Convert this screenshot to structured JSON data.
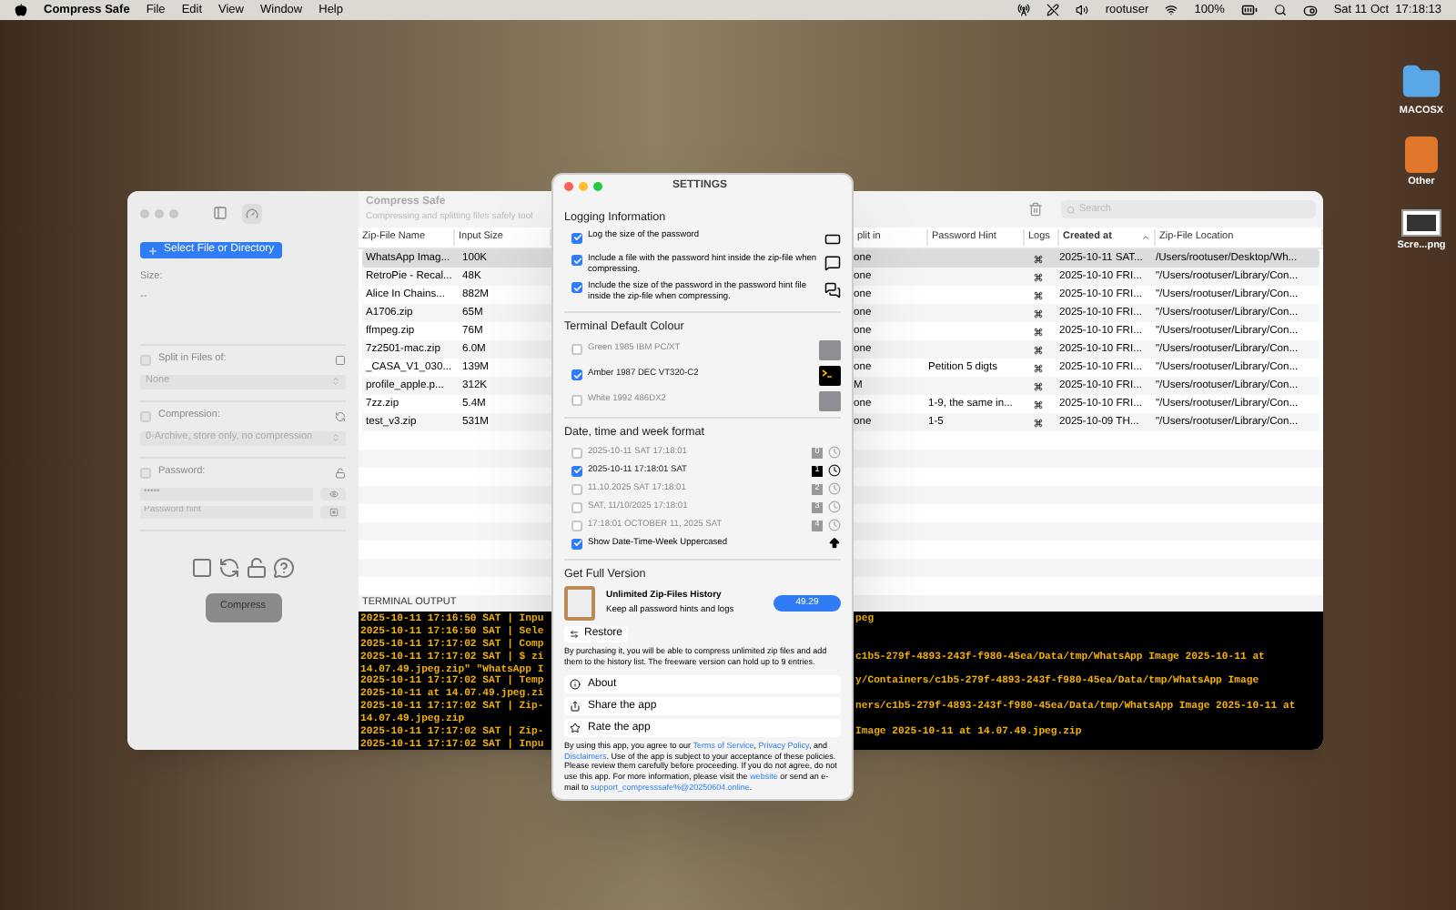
{
  "menu_bar": {
    "app_name": "Compress Safe",
    "menus": [
      "File",
      "Edit",
      "View",
      "Window",
      "Help"
    ],
    "user": "rootuser",
    "battery": "100%",
    "clock": "Sat 11 Oct  17:18:13"
  },
  "desktop_icons": [
    {
      "label": "MACOSX",
      "kind": "folder"
    },
    {
      "label": "Other",
      "kind": "app"
    },
    {
      "label": "Scre...png",
      "kind": "screenshot"
    }
  ],
  "main_window": {
    "sidebar": {
      "select_button": "Select File or Directory",
      "size_label": "Size:",
      "size_value": "--",
      "split": {
        "label": "Split in Files of:",
        "checked": false,
        "value": "None"
      },
      "compression": {
        "label": "Compression:",
        "checked": false,
        "value": "0-Archive, store only, no compression"
      },
      "password": {
        "label": "Password:",
        "checked": false,
        "value": "•••••",
        "hint_placeholder": "Password hint"
      },
      "compress_button": "Compress"
    },
    "header": {
      "title": "Compress Safe",
      "subtitle": "Compressing and splitting files safely tool",
      "search_placeholder": "Search"
    },
    "table": {
      "columns": [
        {
          "label": "Zip-File Name",
          "sorted": false
        },
        {
          "label": "Input Size",
          "sorted": false
        },
        {
          "label": "plit in",
          "sorted": false
        },
        {
          "label": "Password Hint",
          "sorted": false
        },
        {
          "label": "Logs",
          "sorted": false
        },
        {
          "label": "Created at",
          "sorted": true
        },
        {
          "label": "Zip-File Location",
          "sorted": false
        }
      ],
      "rows": [
        {
          "selected": true,
          "cells": [
            "WhatsApp Imag...",
            "100K",
            "one",
            "",
            "",
            "2025-10-11 SAT...",
            "/Users/rootuser/Desktop/Wh..."
          ]
        },
        {
          "selected": false,
          "cells": [
            "RetroPie - Recal...",
            "48K",
            "one",
            "",
            "",
            "2025-10-10 FRI...",
            "\"/Users/rootuser/Library/Con..."
          ]
        },
        {
          "selected": false,
          "cells": [
            "Alice In Chains...",
            "882M",
            "one",
            "",
            "",
            "2025-10-10 FRI...",
            "\"/Users/rootuser/Library/Con..."
          ]
        },
        {
          "selected": false,
          "cells": [
            "A1706.zip",
            "65M",
            "one",
            "",
            "",
            "2025-10-10 FRI...",
            "\"/Users/rootuser/Library/Con..."
          ]
        },
        {
          "selected": false,
          "cells": [
            "ffmpeg.zip",
            "76M",
            "one",
            "",
            "",
            "2025-10-10 FRI...",
            "\"/Users/rootuser/Library/Con..."
          ]
        },
        {
          "selected": false,
          "cells": [
            "7z2501-mac.zip",
            "6.0M",
            "one",
            "",
            "",
            "2025-10-10 FRI...",
            "\"/Users/rootuser/Library/Con..."
          ]
        },
        {
          "selected": false,
          "cells": [
            "_CASA_V1_030...",
            "139M",
            "one",
            "Petition 5 digts",
            "",
            "2025-10-10 FRI...",
            "\"/Users/rootuser/Library/Con..."
          ]
        },
        {
          "selected": false,
          "cells": [
            "profile_apple.p...",
            "312K",
            "M",
            "",
            "",
            "2025-10-10 FRI...",
            "\"/Users/rootuser/Library/Con..."
          ]
        },
        {
          "selected": false,
          "cells": [
            "7zz.zip",
            "5.4M",
            "one",
            "1-9, the same in...",
            "",
            "2025-10-10 FRI...",
            "\"/Users/rootuser/Library/Con..."
          ]
        },
        {
          "selected": false,
          "cells": [
            "test_v3.zip",
            "531M",
            "one",
            "1-5",
            "",
            "2025-10-09 TH...",
            "\"/Users/rootuser/Library/Con..."
          ]
        }
      ]
    },
    "terminal": {
      "title": "TERMINAL OUTPUT",
      "lines": [
        {
          "left": "2025-10-11 17:16:50 SAT | Inpu",
          "right": "peg"
        },
        {
          "left": "2025-10-11 17:16:50 SAT | Sele"
        },
        {
          "left": "2025-10-11 17:17:02 SAT | Comp"
        },
        {
          "left": "2025-10-11 17:17:02 SAT | $ zi",
          "right": "c1b5-279f-4893-243f-f980-45ea/Data/tmp/WhatsApp Image 2025-10-11 at"
        },
        {
          "left": "14.07.49.jpeg.zip\" \"WhatsApp I"
        },
        {
          "left": "2025-10-11 17:17:02 SAT | Temp",
          "right": "y/Containers/c1b5-279f-4893-243f-f980-45ea/Data/tmp/WhatsApp Image"
        },
        {
          "left": "2025-10-11 at 14.07.49.jpeg.zi"
        },
        {
          "left": "2025-10-11 17:17:02 SAT | Zip-",
          "right": "ners/c1b5-279f-4893-243f-f980-45ea/Data/tmp/WhatsApp Image 2025-10-11 at"
        },
        {
          "left": "14.07.49.jpeg.zip"
        },
        {
          "left": "2025-10-11 17:17:02 SAT | Zip-",
          "right": "Image 2025-10-11 at 14.07.49.jpeg.zip"
        },
        {
          "left": "2025-10-11 17:17:02 SAT | Inpu"
        }
      ]
    }
  },
  "settings": {
    "title": "SETTINGS",
    "logging": {
      "heading": "Logging Information",
      "options": [
        {
          "label": "Log the size of the password",
          "checked": true
        },
        {
          "label": "Include a file with the password hint inside the zip-file when compressing.",
          "checked": true
        },
        {
          "label": "Include the size of the password in the password hint file inside the zip-file when compressing.",
          "checked": true
        }
      ]
    },
    "terminal_colour": {
      "heading": "Terminal Default Colour",
      "options": [
        {
          "label": "Green 1985 IBM PC/XT",
          "checked": false
        },
        {
          "label": "Amber 1987 DEC VT320-C2",
          "checked": true
        },
        {
          "label": "White 1992 486DX2",
          "checked": false
        }
      ]
    },
    "date_format": {
      "heading": "Date, time and week format",
      "options": [
        {
          "label": "2025-10-11 SAT 17:18:01",
          "badge": "0",
          "checked": false
        },
        {
          "label": "2025-10-11 17:18:01 SAT",
          "badge": "1",
          "checked": true
        },
        {
          "label": "11.10.2025 SAT 17:18:01",
          "badge": "2",
          "checked": false
        },
        {
          "label": "SAT, 11/10/2025 17:18:01",
          "badge": "3",
          "checked": false
        },
        {
          "label": "17:18:01 OCTOBER 11, 2025 SAT",
          "badge": "4",
          "checked": false
        }
      ],
      "uppercase": {
        "label": "Show Date-Time-Week Uppercased",
        "checked": true
      }
    },
    "full_version": {
      "heading": "Get Full Version",
      "product": "Unlimited Zip-Files History",
      "description": "Keep all password hints and logs",
      "price": "49.29",
      "restore": "Restore",
      "note": "By purchasing it, you will be able to compress unlimited zip files and add them to the history list. The freeware version can hold up to 9 entries."
    },
    "links": [
      {
        "label": "About"
      },
      {
        "label": "Share the app"
      },
      {
        "label": "Rate the app"
      }
    ],
    "legal": [
      {
        "text": "By using this app, you agree to our ",
        "kind": "text"
      },
      {
        "text": "Terms of Service",
        "kind": "link"
      },
      {
        "text": ", ",
        "kind": "text"
      },
      {
        "text": "Privacy Policy",
        "kind": "link"
      },
      {
        "text": ", and ",
        "kind": "text"
      },
      {
        "text": "Disclaimers",
        "kind": "link"
      },
      {
        "text": ". Use of the app is subject to your acceptance of these policies. Please review them carefully before proceeding. If you do not agree, do not use this app. For more information, please visit the ",
        "kind": "text"
      },
      {
        "text": "website",
        "kind": "link"
      },
      {
        "text": " or send an e-mail to ",
        "kind": "text"
      },
      {
        "text": "support_compresssafe%@20250604.online",
        "kind": "link"
      },
      {
        "text": ".",
        "kind": "text"
      }
    ]
  }
}
